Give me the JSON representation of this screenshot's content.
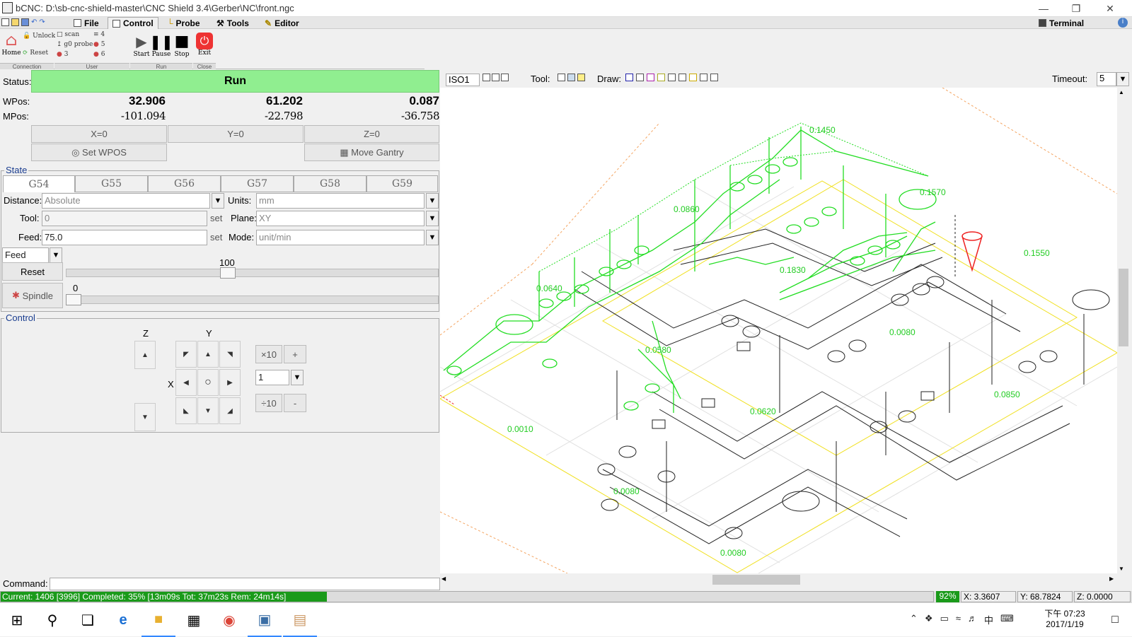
{
  "window": {
    "title": "bCNC: D:\\sb-cnc-shield-master\\CNC Shield 3.4\\Gerber\\NC\\front.ngc"
  },
  "menu": {
    "file": "File",
    "control": "Control",
    "probe": "Probe",
    "tools": "Tools",
    "editor": "Editor",
    "terminal": "Terminal"
  },
  "ribbon": {
    "home": "Home",
    "unlock": "Unlock",
    "reset": "Reset",
    "scan": "scan",
    "g0probe": "g0 probe",
    "u3": "3",
    "u4": "4",
    "u5": "5",
    "u6": "6",
    "start": "Start",
    "pause": "Pause",
    "stop": "Stop",
    "exit": "Exit",
    "grp_connection": "Connection",
    "grp_user": "User",
    "grp_run": "Run",
    "grp_close": "Close"
  },
  "status": {
    "label": "Status:",
    "value": "Run",
    "color": "#90ee90"
  },
  "wpos": {
    "label": "WPos:",
    "x": "32.906",
    "y": "61.202",
    "z": "0.087"
  },
  "mpos": {
    "label": "MPos:",
    "x": "-101.094",
    "y": "-22.798",
    "z": "-36.758"
  },
  "zero": {
    "x": "X=0",
    "y": "Y=0",
    "z": "Z=0"
  },
  "setwpos": "Set WPOS",
  "movegantry": "Move Gantry",
  "state": {
    "title": "State",
    "tabs": [
      "G54",
      "G55",
      "G56",
      "G57",
      "G58",
      "G59"
    ],
    "distance_label": "Distance:",
    "distance": "Absolute",
    "units_label": "Units:",
    "units": "mm",
    "tool_label": "Tool:",
    "tool": "0",
    "set": "set",
    "plane_label": "Plane:",
    "plane": "XY",
    "feed_label": "Feed:",
    "feed": "75.0",
    "mode_label": "Mode:",
    "mode": "unit/min",
    "override": "Feed",
    "override_value": "100",
    "reset": "Reset",
    "spindle": "Spindle",
    "spindle_value": "0"
  },
  "control": {
    "title": "Control",
    "z": "Z",
    "y": "Y",
    "x": "X",
    "x10": "×10",
    "plus": "+",
    "div10": "÷10",
    "minus": "-",
    "step": "1"
  },
  "plot": {
    "view": "ISO1",
    "tool_label": "Tool:",
    "draw_label": "Draw:",
    "timeout_label": "Timeout:",
    "timeout": "5",
    "dims": [
      "0.1450",
      "0.1570",
      "0.0860",
      "0.1550",
      "0.0640",
      "0.1830",
      "0.0080",
      "0.0580",
      "0.0850",
      "0.0010",
      "0.0620",
      "0.0080",
      "0.0080"
    ]
  },
  "command": {
    "label": "Command:"
  },
  "statusbar": {
    "progress_text": "Current: 1406 [3996]  Completed: 35% [13m09s Tot: 37m23s Rem: 24m14s]",
    "progress": 0.35,
    "percent": "92%",
    "x": "X: 3.3607",
    "y": "Y: 68.7824",
    "z": "Z: 0.0000"
  },
  "taskbar": {
    "time": "下午 07:23",
    "date": "2017/1/19",
    "ime": "中"
  }
}
